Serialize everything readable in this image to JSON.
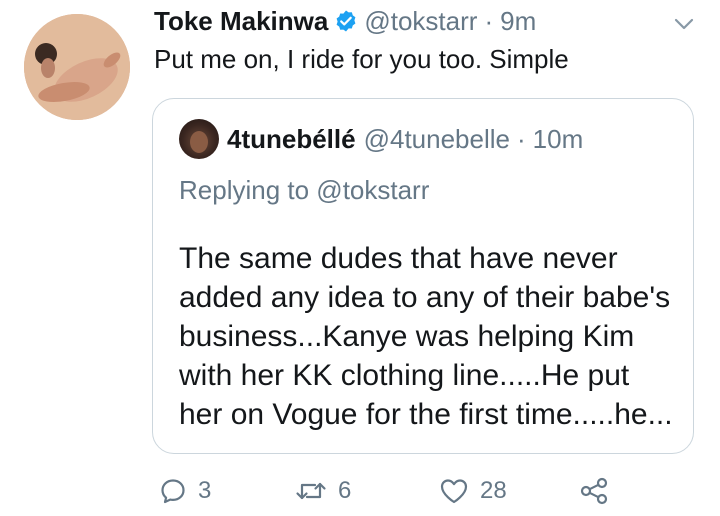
{
  "tweet": {
    "author_name": "Toke Makinwa",
    "author_handle": "@tokstarr",
    "separator": "·",
    "time": "9m",
    "text": "Put me on, I ride for you too. Simple"
  },
  "quoted_tweet": {
    "author_name": "4tunebéllé",
    "author_handle": "@4tunebelle",
    "separator": "·",
    "time": "10m",
    "replying_to": "Replying to @tokstarr",
    "text": "The same dudes that have never\nadded any idea to any of their babe's\nbusiness...Kanye was helping Kim\nwith her KK clothing line.....He put\nher on Vogue for the first time.....he..."
  },
  "actions": {
    "reply_count": "3",
    "retweet_count": "6",
    "like_count": "28"
  },
  "colors": {
    "verified": "#1da1f2",
    "secondary_text": "#657786",
    "border": "#ccd6dd"
  },
  "icons": [
    "verified-badge-icon",
    "chevron-down-icon",
    "reply-icon",
    "retweet-icon",
    "like-icon",
    "share-icon"
  ]
}
